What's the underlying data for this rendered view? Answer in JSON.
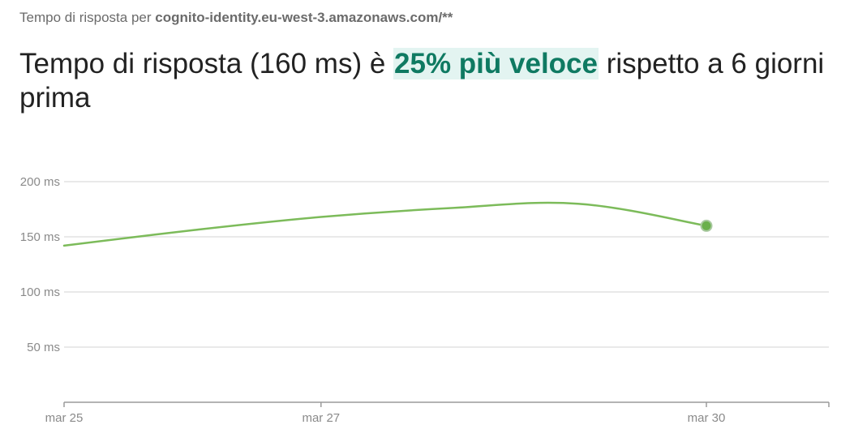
{
  "header": {
    "subtitle_prefix": "Tempo di risposta per",
    "subtitle_host": "cognito-identity.eu-west-3.amazonaws.com/**",
    "headline_before": "Tempo di risposta (160 ms) è",
    "headline_highlight": "25% più veloce",
    "headline_after": "rispetto a 6 giorni prima"
  },
  "colors": {
    "line": "#7cbb5a",
    "marker": "#6ab04c",
    "highlight_text": "#0f7a62",
    "highlight_bg": "#e3f4f1",
    "grid": "#e2e2e2"
  },
  "chart_data": {
    "type": "line",
    "title": "",
    "xlabel": "",
    "ylabel": "",
    "x_unit": "day",
    "x_ticks": [
      "mar 25",
      "mar 27",
      "mar 30"
    ],
    "y_ticks": [
      "200 ms",
      "150 ms",
      "100 ms",
      "50 ms"
    ],
    "ylim": [
      0,
      200
    ],
    "grid": true,
    "series": [
      {
        "x": [
          "mar 25",
          "mar 26",
          "mar 27",
          "mar 28",
          "mar 29",
          "mar 30"
        ],
        "values": [
          142,
          156,
          168,
          176,
          180,
          160
        ]
      }
    ],
    "last_point_marker": true
  }
}
